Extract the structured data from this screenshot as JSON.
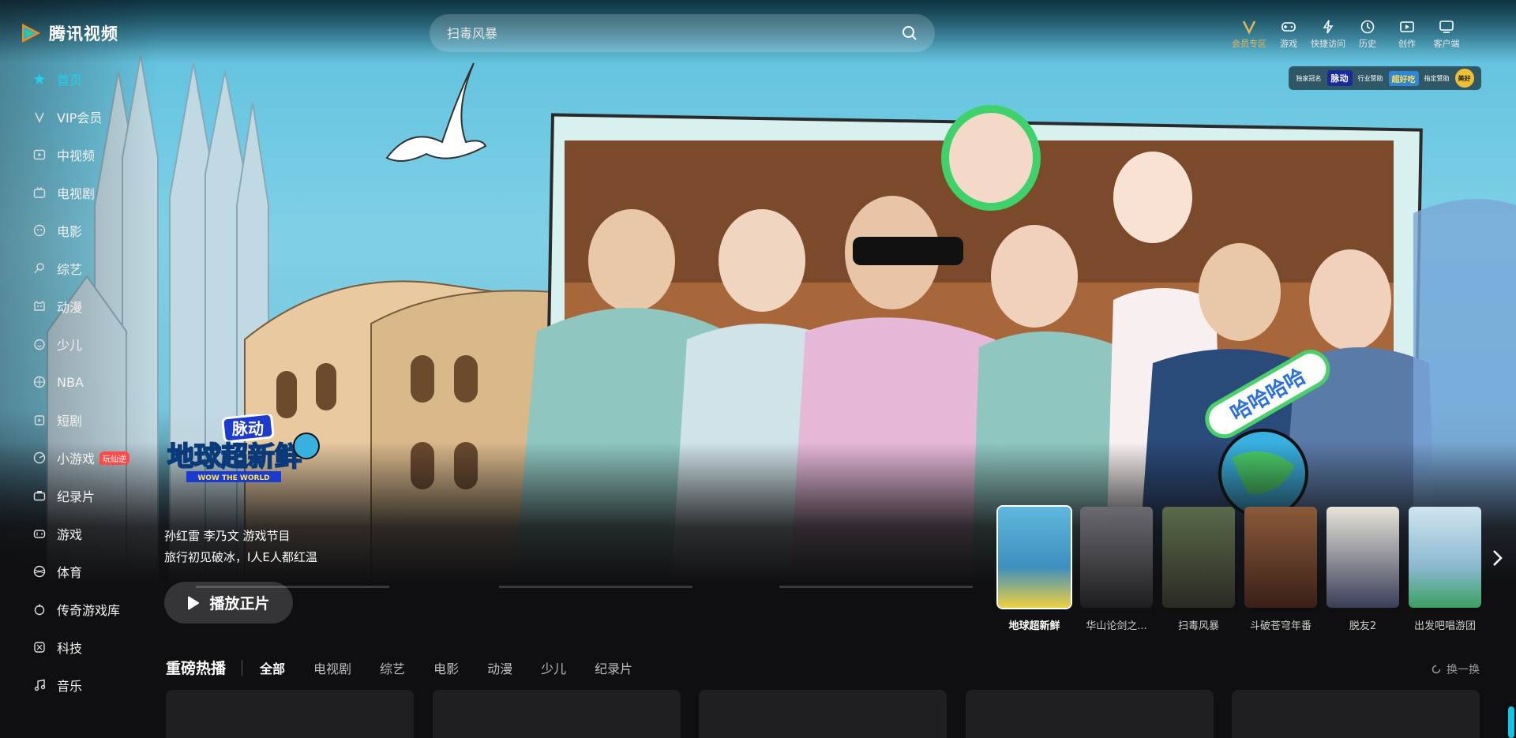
{
  "app": {
    "logo_text": "腾讯视频"
  },
  "search": {
    "placeholder": "扫毒风暴"
  },
  "top_actions": [
    {
      "label": "会员专区",
      "icon": "vip-icon"
    },
    {
      "label": "游戏",
      "icon": "gamepad-icon"
    },
    {
      "label": "快捷访问",
      "icon": "lightning-icon"
    },
    {
      "label": "历史",
      "icon": "clock-icon"
    },
    {
      "label": "创作",
      "icon": "create-icon"
    },
    {
      "label": "客户端",
      "icon": "monitor-icon"
    }
  ],
  "sponsor": {
    "label1": "独家冠名",
    "brand1": "脉动",
    "label2": "行业赞助",
    "brand2": "超好吃",
    "label3": "指定赞助",
    "brand3": "美好"
  },
  "sidebar": {
    "items": [
      {
        "label": "首页",
        "icon": "star-icon",
        "active": true
      },
      {
        "label": "VIP会员",
        "icon": "vip-v-icon"
      },
      {
        "label": "中视频",
        "icon": "play-square-icon"
      },
      {
        "label": "电视剧",
        "icon": "tv-icon"
      },
      {
        "label": "电影",
        "icon": "film-reel-icon"
      },
      {
        "label": "综艺",
        "icon": "mic-icon"
      },
      {
        "label": "动漫",
        "icon": "cartoon-face-icon"
      },
      {
        "label": "少儿",
        "icon": "child-face-icon"
      },
      {
        "label": "NBA",
        "icon": "basketball-icon"
      },
      {
        "label": "短剧",
        "icon": "short-drama-icon"
      },
      {
        "label": "小游戏",
        "icon": "mini-game-icon",
        "badge": "玩仙逆"
      },
      {
        "label": "纪录片",
        "icon": "camera-icon"
      },
      {
        "label": "游戏",
        "icon": "gamepad-icon"
      },
      {
        "label": "体育",
        "icon": "ball-icon"
      },
      {
        "label": "传奇游戏库",
        "icon": "legend-icon"
      },
      {
        "label": "科技",
        "icon": "tech-icon"
      },
      {
        "label": "音乐",
        "icon": "music-note-icon"
      }
    ]
  },
  "hero": {
    "show_logo_brand": "脉动",
    "show_logo_title": "地球超新鲜",
    "show_logo_sub": "WOW THE WORLD",
    "cast_line": "孙红雷 李乃文 游戏节目",
    "tagline": "旅行初见破冰，I人E人都红温",
    "play_label": "播放正片",
    "bubble_text": "哈哈哈哈"
  },
  "thumbnails": [
    {
      "title": "地球超新鲜",
      "color": "#3d8fbf",
      "active": true
    },
    {
      "title": "华山论剑之...",
      "color": "#2a2a2e"
    },
    {
      "title": "扫毒风暴",
      "color": "#4a5a3a"
    },
    {
      "title": "斗破苍穹年番",
      "color": "#6a3a2a"
    },
    {
      "title": "脱友2",
      "color": "#3a3f5a"
    },
    {
      "title": "出发吧唱游团",
      "color": "#8ab8cf"
    }
  ],
  "section": {
    "title": "重磅热播",
    "tabs": [
      "全部",
      "电视剧",
      "综艺",
      "电影",
      "动漫",
      "少儿",
      "纪录片"
    ],
    "refresh_label": "换一换"
  }
}
